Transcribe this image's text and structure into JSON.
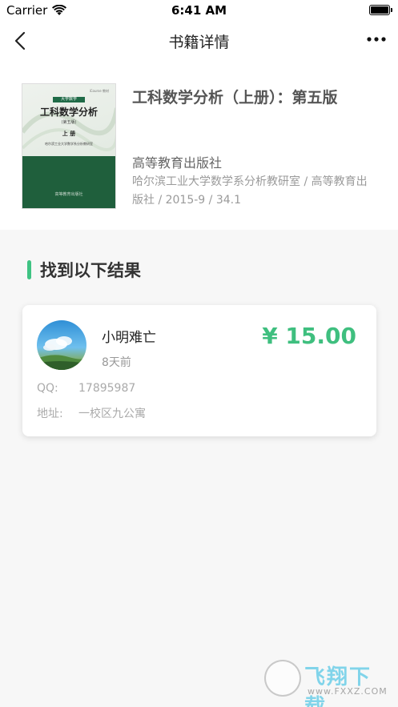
{
  "status_bar": {
    "carrier": "Carrier",
    "time": "6:41 AM"
  },
  "nav": {
    "title": "书籍详情"
  },
  "book": {
    "cover": {
      "badge": "大学数学",
      "logo": "iCourse 教材",
      "title": "工科数学分析",
      "edition": "(第五版)",
      "volume": "上 册",
      "author": "哈尔滨工业大学数学系分析教研室",
      "publisher": "高等教育出版社"
    },
    "title": "工科数学分析（上册）：第五版",
    "publisher": "高等教育出版社",
    "meta": "哈尔滨工业大学数学系分析教研室 / 高等教育出版社 / 2015-9 / 34.1"
  },
  "results": {
    "heading": "找到以下结果",
    "items": [
      {
        "seller_name": "小明难亡",
        "time_ago": "8天前",
        "price": "¥ 15.00",
        "qq_label": "QQ:",
        "qq_value": "17895987",
        "address_label": "地址:",
        "address_value": "一校区九公寓"
      }
    ]
  },
  "watermark": {
    "brand": "飞翔下载",
    "url": "www.FXXZ.COM"
  },
  "colors": {
    "accent": "#3fc383",
    "price": "#3fbf7f",
    "cover_green": "#1f5f3c"
  }
}
